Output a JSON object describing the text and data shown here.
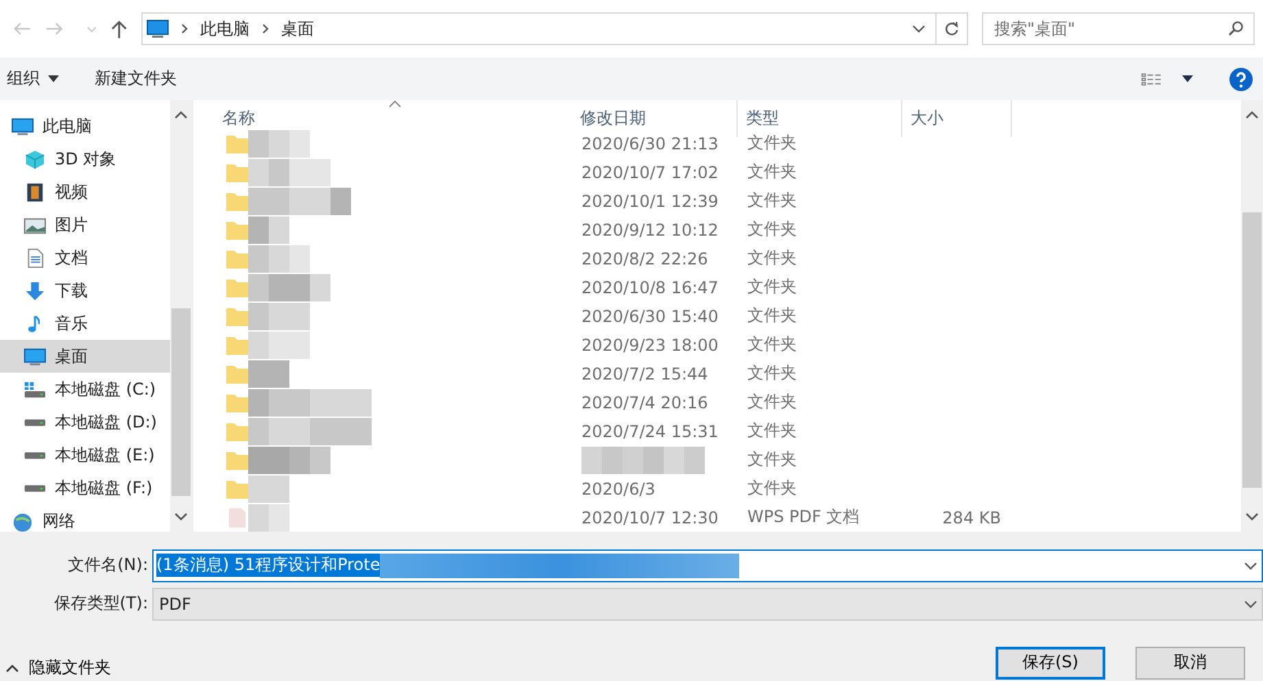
{
  "address_bar": {
    "path": [
      "此电脑",
      "桌面"
    ]
  },
  "search": {
    "placeholder": "搜索\"桌面\""
  },
  "toolbar": {
    "organize": "组织",
    "new_folder": "新建文件夹"
  },
  "sidebar": {
    "items": [
      {
        "label": "此电脑",
        "selected": false
      },
      {
        "label": "3D 对象",
        "selected": false
      },
      {
        "label": "视频",
        "selected": false
      },
      {
        "label": "图片",
        "selected": false
      },
      {
        "label": "文档",
        "selected": false
      },
      {
        "label": "下载",
        "selected": false
      },
      {
        "label": "音乐",
        "selected": false
      },
      {
        "label": "桌面",
        "selected": true
      },
      {
        "label": "本地磁盘 (C:)",
        "selected": false
      },
      {
        "label": "本地磁盘 (D:)",
        "selected": false
      },
      {
        "label": "本地磁盘 (E:)",
        "selected": false
      },
      {
        "label": "本地磁盘 (F:)",
        "selected": false
      },
      {
        "label": "网络",
        "selected": false
      }
    ]
  },
  "table": {
    "columns": [
      "名称",
      "修改日期",
      "类型",
      "大小"
    ],
    "rows": [
      {
        "kind": "folder",
        "date": "2020/6/30 21:13",
        "type": "文件夹"
      },
      {
        "kind": "folder",
        "date": "2020/10/7 17:02",
        "type": "文件夹"
      },
      {
        "kind": "folder",
        "date": "2020/10/1 12:39",
        "type": "文件夹"
      },
      {
        "kind": "folder",
        "date": "2020/9/12 10:12",
        "type": "文件夹"
      },
      {
        "kind": "folder",
        "date": "2020/8/2 22:26",
        "type": "文件夹"
      },
      {
        "kind": "folder",
        "date": "2020/10/8 16:47",
        "type": "文件夹"
      },
      {
        "kind": "folder",
        "date": "2020/6/30 15:40",
        "type": "文件夹"
      },
      {
        "kind": "folder",
        "date": "2020/9/23 18:00",
        "type": "文件夹"
      },
      {
        "kind": "folder",
        "date": "2020/7/2 15:44",
        "type": "文件夹"
      },
      {
        "kind": "folder",
        "date": "2020/7/4 20:16",
        "type": "文件夹"
      },
      {
        "kind": "folder",
        "date": "2020/7/24 15:31",
        "type": "文件夹"
      },
      {
        "kind": "folder",
        "type": "文件夹"
      },
      {
        "kind": "folder",
        "date": "2020/6/3",
        "type": "文件夹"
      },
      {
        "kind": "file",
        "date": "2020/10/7 12:30",
        "type": "WPS PDF 文档",
        "size": "284 KB"
      }
    ]
  },
  "form": {
    "filename_label": "文件名(N):",
    "filename": "(1条消息) 51程序设计和Prote",
    "filetype_label": "保存类型(T):",
    "filetype": "PDF"
  },
  "hide_folders": "隐藏文件夹",
  "buttons": [
    {
      "label": "保存(S)",
      "default": true
    },
    {
      "label": "取消",
      "default": false
    }
  ]
}
